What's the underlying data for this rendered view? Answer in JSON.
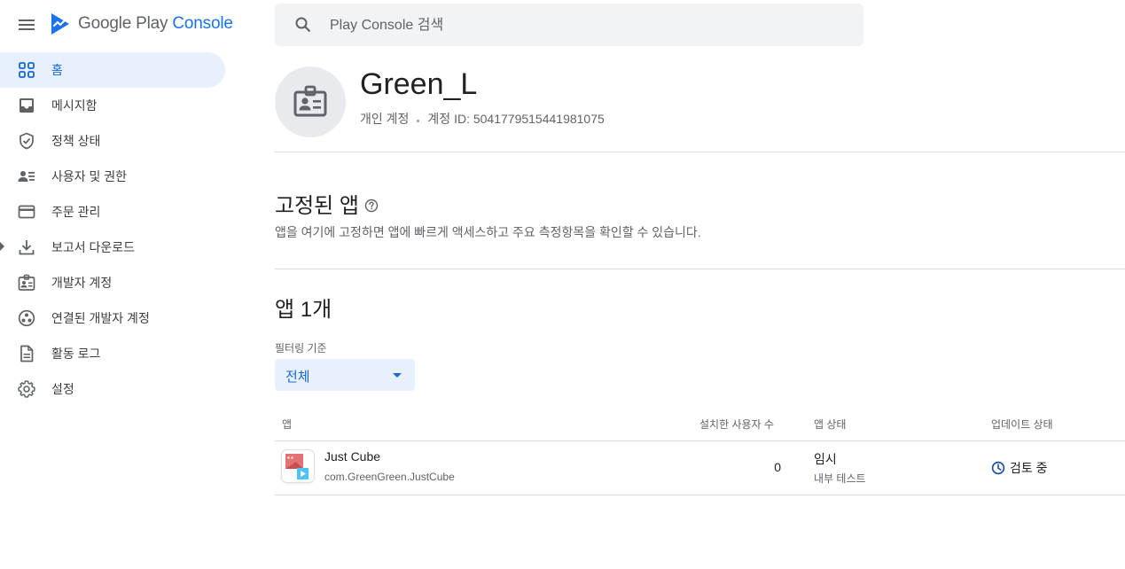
{
  "header": {
    "logo_google_play": "Google Play",
    "logo_console": "Console",
    "search_placeholder": "Play Console 검색"
  },
  "sidebar": {
    "items": [
      {
        "label": "홈",
        "icon": "home-grid-icon",
        "active": true
      },
      {
        "label": "메시지함",
        "icon": "inbox-icon"
      },
      {
        "label": "정책 상태",
        "icon": "shield-check-icon"
      },
      {
        "label": "사용자 및 권한",
        "icon": "users-permissions-icon"
      },
      {
        "label": "주문 관리",
        "icon": "credit-card-icon"
      },
      {
        "label": "보고서 다운로드",
        "icon": "download-icon"
      },
      {
        "label": "개발자 계정",
        "icon": "badge-icon"
      },
      {
        "label": "연결된 개발자 계정",
        "icon": "linked-accounts-icon"
      },
      {
        "label": "활동 로그",
        "icon": "document-icon"
      },
      {
        "label": "설정",
        "icon": "gear-icon"
      }
    ]
  },
  "account": {
    "name": "Green_L",
    "type": "개인 계정",
    "id_label": "계정 ID: 5041779515441981075"
  },
  "pinned": {
    "title": "고정된 앱",
    "description": "앱을 여기에 고정하면 앱에 빠르게 액세스하고 주요 측정항목을 확인할 수 있습니다."
  },
  "apps": {
    "title": "앱 1개",
    "filter_label": "필터링 기준",
    "filter_value": "전체",
    "columns": {
      "app": "앱",
      "installs": "설치한 사용자 수",
      "app_status": "앱 상태",
      "update_status": "업데이트 상태"
    },
    "rows": [
      {
        "name": "Just Cube",
        "package": "com.GreenGreen.JustCube",
        "installs": "0",
        "status": "임시",
        "status_sub": "내부 테스트",
        "update_status": "검토 중"
      }
    ]
  },
  "colors": {
    "accent": "#1a73e8",
    "active_bg": "#e8f0fe",
    "active_text": "#1967d2"
  }
}
